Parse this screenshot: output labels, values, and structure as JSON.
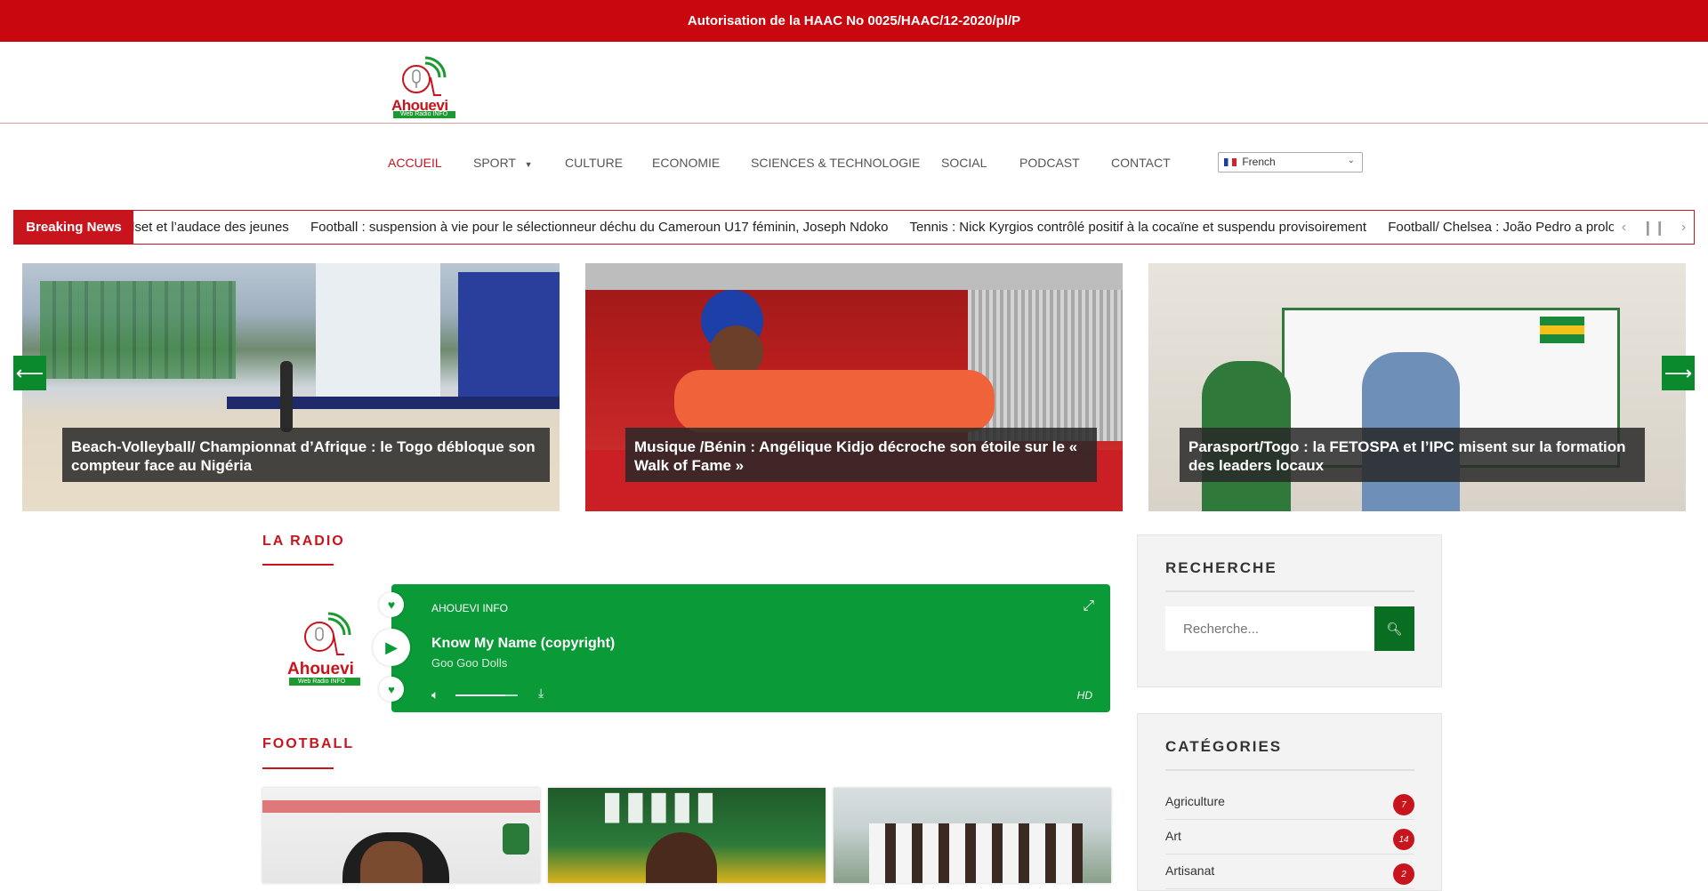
{
  "topbar": {
    "text": "Autorisation de la HAAC No 0025/HAAC/12-2020/pl/P"
  },
  "brand": {
    "name": "Ahouevi",
    "tagline": "Web Radio INFO",
    "accent": "#c8141c",
    "green": "#0a9a38"
  },
  "nav": {
    "items": [
      {
        "label": "ACCUEIL"
      },
      {
        "label": "SPORT"
      },
      {
        "label": "CULTURE"
      },
      {
        "label": "ECONOMIE"
      },
      {
        "label": "SCIENCES & TECHNOLOGIE"
      },
      {
        "label": "SOCIAL"
      },
      {
        "label": "PODCAST"
      },
      {
        "label": "CONTACT"
      }
    ],
    "language": "French"
  },
  "ticker": {
    "label": "Breaking News",
    "items": [
      "dset et l’audace des jeunes",
      "Football : suspension à vie pour le sélectionneur déchu du Cameroun U17 féminin, Joseph Ndoko",
      "Tennis : Nick Kyrgios contrôlé positif à la cocaïne et suspendu provisoirement",
      "Football/ Chelsea : João Pedro a prolongé"
    ]
  },
  "slider": {
    "slides": [
      {
        "caption": "Beach-Volleyball/ Championnat d’Afrique : le Togo débloque son compteur face au Nigéria"
      },
      {
        "caption": "Musique /Bénin : Angélique Kidjo décroche son étoile sur le « Walk of Fame »"
      },
      {
        "caption": "Parasport/Togo :  la FETOSPA et l’IPC misent sur la formation des leaders locaux"
      }
    ]
  },
  "radio": {
    "section_title": "LA RADIO",
    "station": "AHOUEVI INFO",
    "song": "Know My Name (copyright)",
    "artist": "Goo Goo Dolls",
    "quality": "HD",
    "volume": 0.8
  },
  "football": {
    "section_title": "FOOTBALL"
  },
  "sidebar": {
    "search_title": "RECHERCHE",
    "search_placeholder": "Recherche...",
    "categories_title": "CATÉGORIES",
    "categories": [
      {
        "name": "Agriculture",
        "count": "7"
      },
      {
        "name": "Art",
        "count": "14"
      },
      {
        "name": "Artisanat",
        "count": "2"
      }
    ]
  }
}
